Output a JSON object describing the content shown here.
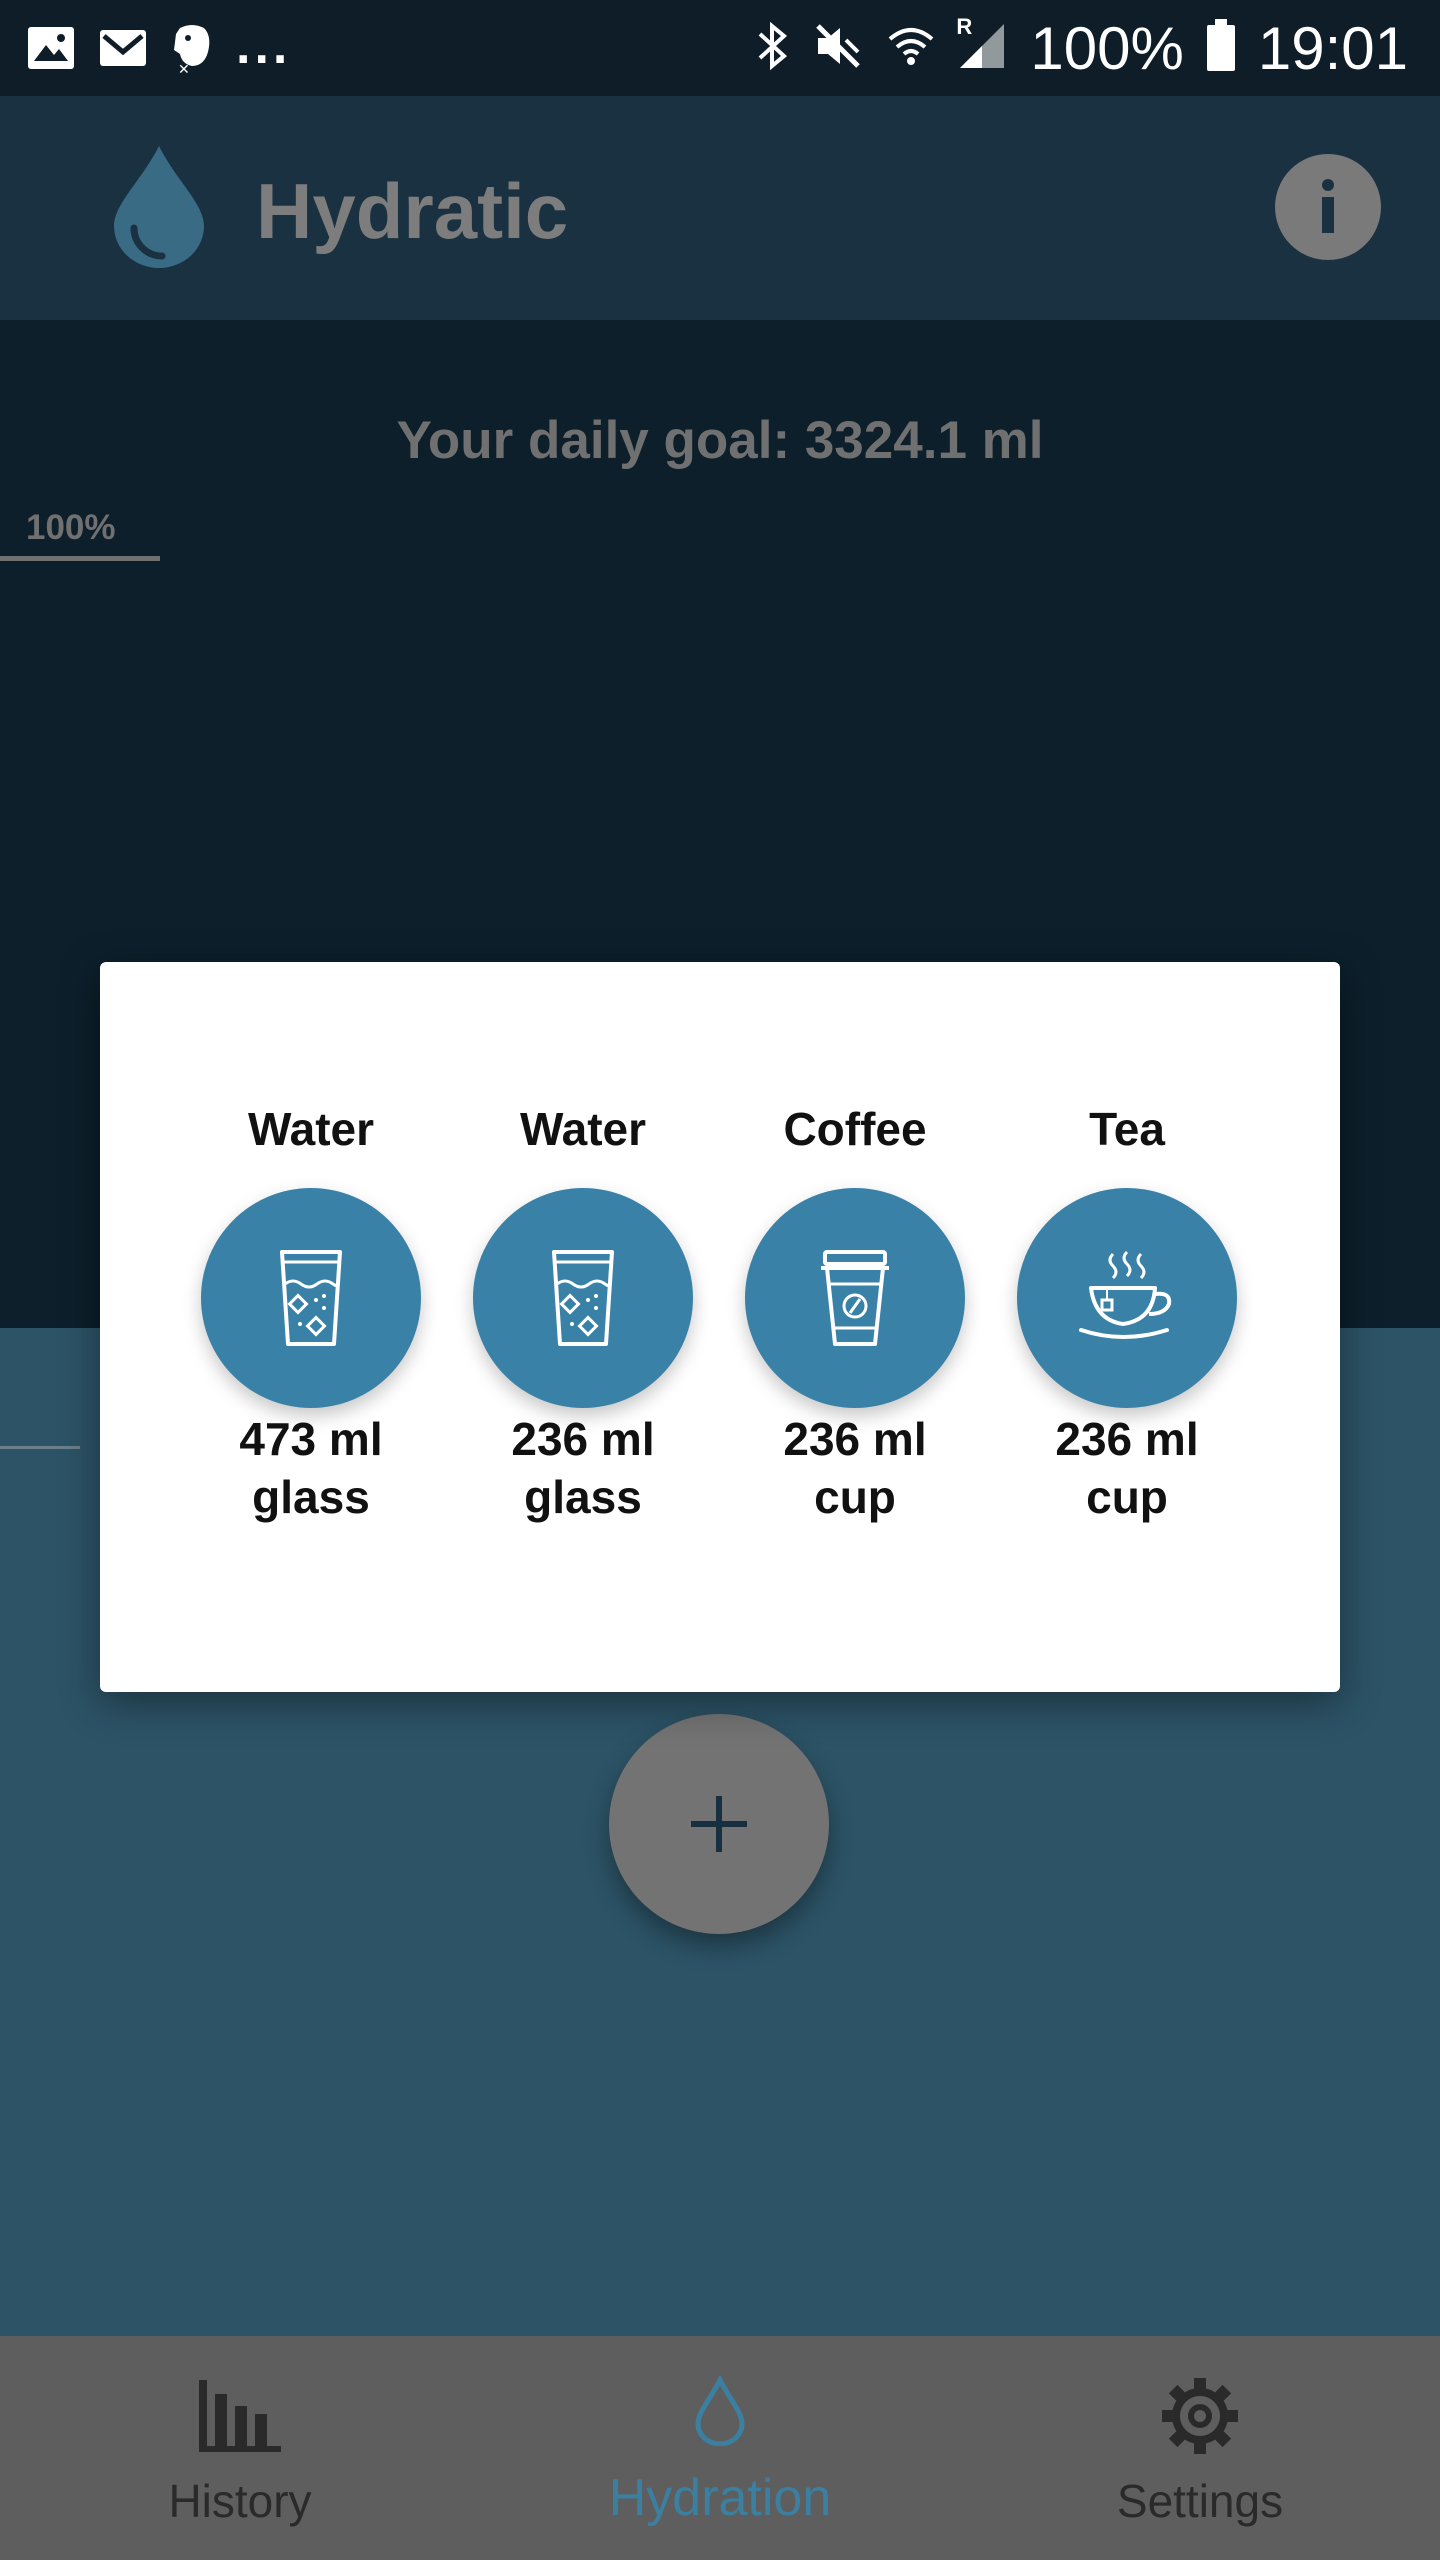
{
  "status_bar": {
    "battery": "100%",
    "time": "19:01",
    "overflow": "...",
    "roaming": "R",
    "left_icons": [
      "image-icon",
      "gmail-icon",
      "evernote-icon"
    ],
    "right_icons": [
      "bluetooth-icon",
      "mute-icon",
      "wifi-icon",
      "signal-icon",
      "battery-icon"
    ]
  },
  "app_bar": {
    "title": "Hydratic",
    "info_icon": "info-icon"
  },
  "main": {
    "goal_text": "Your daily goal: 3324.1 ml",
    "percent_marker": "100%",
    "add_button_icon": "plus-icon"
  },
  "dialog": {
    "options": [
      {
        "name": "Water",
        "size": "473 ml",
        "container": "glass",
        "icon": "glass-water-icon"
      },
      {
        "name": "Water",
        "size": "236 ml",
        "container": "glass",
        "icon": "glass-water-icon"
      },
      {
        "name": "Coffee",
        "size": "236 ml",
        "container": "cup",
        "icon": "coffee-cup-icon"
      },
      {
        "name": "Tea",
        "size": "236 ml",
        "container": "cup",
        "icon": "tea-cup-icon"
      }
    ]
  },
  "bottom_nav": {
    "items": [
      {
        "label": "History",
        "icon": "bar-chart-icon"
      },
      {
        "label": "Hydration",
        "icon": "drop-icon",
        "active": true
      },
      {
        "label": "Settings",
        "icon": "gear-icon"
      }
    ]
  },
  "colors": {
    "status_bar": "#0e1d27",
    "app_bar": "#1a3141",
    "upper_panel": "#0c1f2b",
    "lower_panel": "#2c5366",
    "accent": "#3a81a8",
    "nav_bg": "#5e5e5e"
  }
}
